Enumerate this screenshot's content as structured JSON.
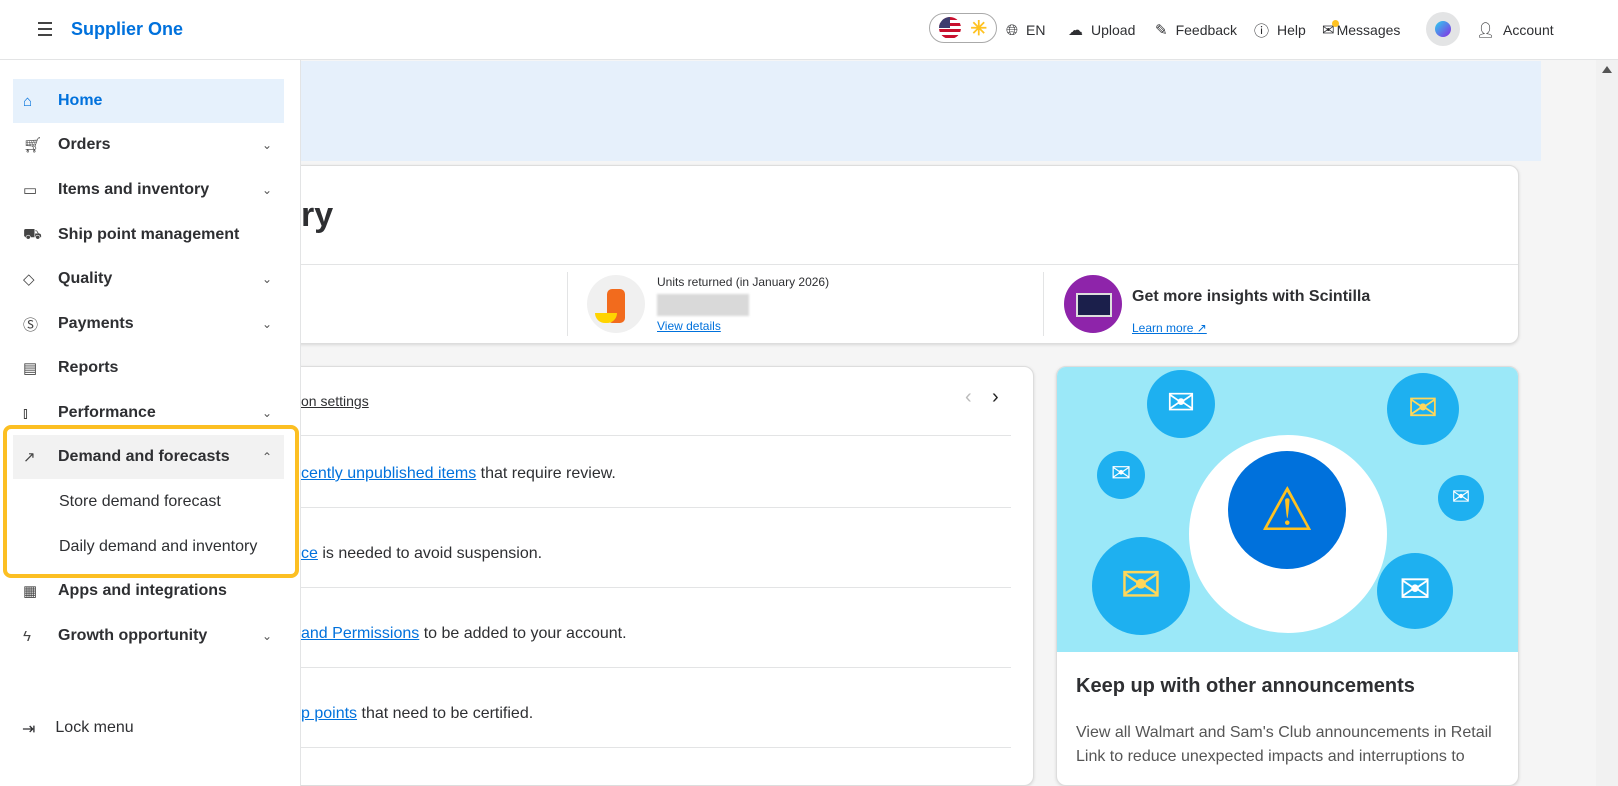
{
  "header": {
    "brand": "Supplier One",
    "lang": "EN",
    "upload": "Upload",
    "feedback": "Feedback",
    "help": "Help",
    "messages": "Messages",
    "account": "Account"
  },
  "sidebar": {
    "items": [
      {
        "label": "Home",
        "icon": "home-icon"
      },
      {
        "label": "Orders",
        "icon": "cart-icon"
      },
      {
        "label": "Items and inventory",
        "icon": "box-icon"
      },
      {
        "label": "Ship point management",
        "icon": "truck-icon"
      },
      {
        "label": "Quality",
        "icon": "diamond-icon"
      },
      {
        "label": "Payments",
        "icon": "dollar-icon"
      },
      {
        "label": "Reports",
        "icon": "clipboard-icon"
      },
      {
        "label": "Performance",
        "icon": "bar-chart-icon"
      },
      {
        "label": "Demand and forecasts",
        "icon": "trend-icon"
      },
      {
        "label": "Apps and integrations",
        "icon": "store-icon"
      },
      {
        "label": "Growth opportunity",
        "icon": "bolt-icon"
      }
    ],
    "sub": [
      "Store demand forecast",
      "Daily demand and inventory"
    ],
    "lock": "Lock menu"
  },
  "summary": {
    "title_fragment": "ry",
    "units_label": "Units returned (in January 2026)",
    "view_details": "View details",
    "insights_title": "Get more insights with Scintilla",
    "learn_more": "Learn more"
  },
  "tasks": {
    "header_fragment": "on settings",
    "rows": [
      {
        "link": "cently unpublished items",
        "rest": " that require review."
      },
      {
        "link": "ce",
        "rest": " is needed to avoid suspension."
      },
      {
        "link": "and Permissions",
        "rest": " to be added to your account."
      },
      {
        "link": "p points",
        "rest": " that need to be certified."
      }
    ]
  },
  "announce": {
    "title": "Keep up with other announcements",
    "body": "View all Walmart and Sam's Club announcements in Retail Link to reduce unexpected impacts and interruptions to"
  },
  "colors": {
    "accent": "#0071dc",
    "highlight": "#fcbf22",
    "announce_bg": "#9be8f8"
  }
}
